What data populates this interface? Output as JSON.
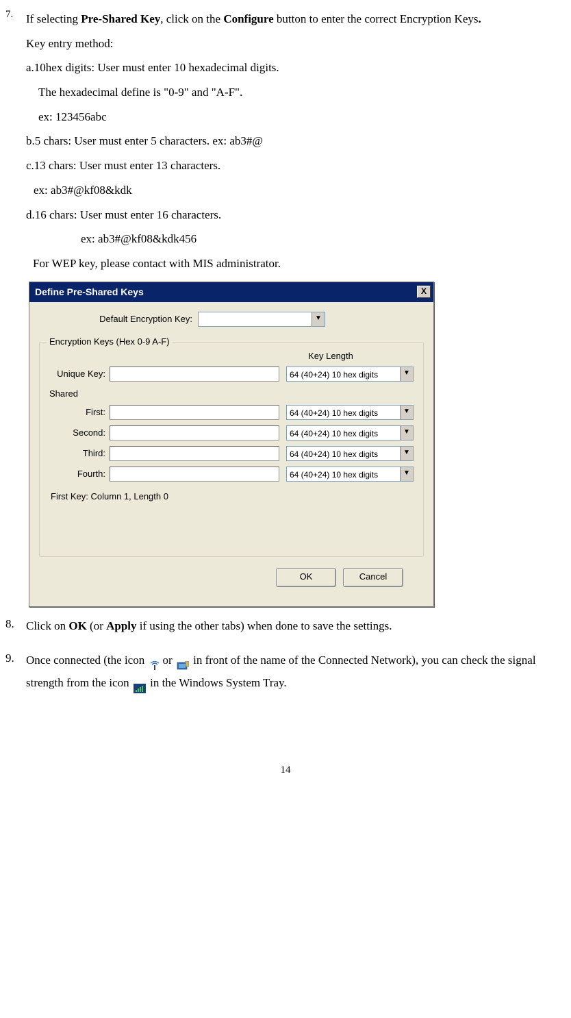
{
  "step7": {
    "intro_before_psk": "If selecting",
    "psk_bold": "Pre-Shared Key",
    "intro_mid": ", click on the",
    "configure_bold": "Configure",
    "intro_after": "button to enter the correct Encryption Keys",
    "period": ".",
    "key_entry": "Key entry method:",
    "a": "a.10hex digits: User must enter 10 hexadecimal digits.",
    "a_line2": "The hexadecimal define is \"0-9\" and \"A-F\".",
    "a_line3": "ex: 123456abc",
    "b": "b.5 chars: User must enter 5 characters. ex: ab3#@",
    "c": "c.13 chars: User must enter 13 characters.",
    "c_ex": "ex: ab3#@kf08&kdk",
    "d": "d.16 chars: User must enter 16 characters.",
    "d_ex": "ex: ab3#@kf08&kdk456",
    "wep_note": "For WEP key, please contact with MIS administrator."
  },
  "dialog": {
    "title": "Define Pre-Shared Keys",
    "close": "X",
    "default_enc_label": "Default Encryption Key:",
    "default_enc_value": "",
    "fieldset_legend": "Encryption Keys (Hex 0-9 A-F)",
    "key_length_header": "Key Length",
    "unique_label": "Unique Key:",
    "shared_label": "Shared",
    "first_label": "First:",
    "second_label": "Second:",
    "third_label": "Third:",
    "fourth_label": "Fourth:",
    "key_len_value": "64  (40+24)  10 hex digits",
    "status": "First Key: Column 1,  Length 0",
    "ok": "OK",
    "cancel": "Cancel"
  },
  "step8": {
    "text_before": "Click on",
    "ok_bold": "OK",
    "text_mid": "(or",
    "apply_bold": "Apply",
    "text_after": "if using the other tabs) when done to save the settings."
  },
  "step9": {
    "line1a": "Once connected (the icon",
    "line1b": "or",
    "line1c": "in front of the name of the Connected Network), you can check the signal strength from the icon",
    "line1d": "in the Windows System Tray."
  },
  "page_number": "14"
}
